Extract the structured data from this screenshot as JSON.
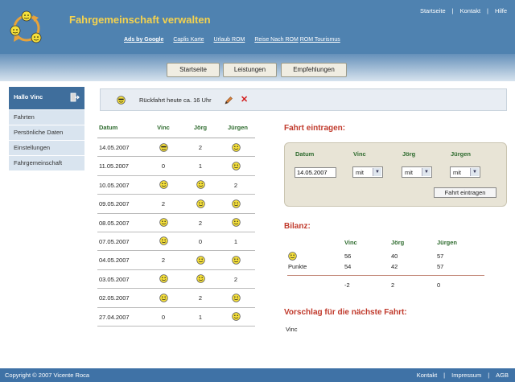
{
  "header": {
    "title": "Fahrgemeinschaft verwalten",
    "topnav": [
      "Startseite",
      "Kontakt",
      "Hilfe"
    ],
    "ads_label": "Ads by Google",
    "ad_links": [
      "Caplis Karte",
      "Urlaub ROM",
      "Reise Nach ROM",
      "ROM Tourismus"
    ]
  },
  "tabs": [
    "Startseite",
    "Leistungen",
    "Empfehlungen"
  ],
  "sidebar": {
    "greeting": "Hallo Vinc",
    "items": [
      "Fahrten",
      "Persönliche Daten",
      "Einstellungen",
      "Fahrgemeinschaft"
    ]
  },
  "notice": {
    "text": "Rückfahrt heute ca. 16 Uhr"
  },
  "rides": {
    "headers": [
      "Datum",
      "Vinc",
      "Jörg",
      "Jürgen"
    ],
    "rows": [
      {
        "date": "14.05.2007",
        "cells": [
          "driver",
          "2",
          "smile"
        ]
      },
      {
        "date": "11.05.2007",
        "cells": [
          "0",
          "1",
          "smile"
        ]
      },
      {
        "date": "10.05.2007",
        "cells": [
          "smile",
          "smile",
          "2"
        ]
      },
      {
        "date": "09.05.2007",
        "cells": [
          "2",
          "smile",
          "smile"
        ]
      },
      {
        "date": "08.05.2007",
        "cells": [
          "smile",
          "2",
          "smile"
        ]
      },
      {
        "date": "07.05.2007",
        "cells": [
          "smile",
          "0",
          "1"
        ]
      },
      {
        "date": "04.05.2007",
        "cells": [
          "2",
          "smile",
          "smile"
        ]
      },
      {
        "date": "03.05.2007",
        "cells": [
          "smile",
          "smile",
          "2"
        ]
      },
      {
        "date": "02.05.2007",
        "cells": [
          "smile",
          "2",
          "smile"
        ]
      },
      {
        "date": "27.04.2007",
        "cells": [
          "0",
          "1",
          "smile"
        ]
      }
    ]
  },
  "entry": {
    "heading": "Fahrt eintragen:",
    "headers": [
      "Datum",
      "Vinc",
      "Jörg",
      "Jürgen"
    ],
    "date_value": "14.05.2007",
    "selects": [
      "mit",
      "mit",
      "mit"
    ],
    "submit_label": "Fahrt eintragen"
  },
  "bilanz": {
    "heading": "Bilanz:",
    "headers": [
      "Vinc",
      "Jörg",
      "Jürgen"
    ],
    "smile_row": [
      "56",
      "40",
      "57"
    ],
    "points_label": "Punkte",
    "points_row": [
      "54",
      "42",
      "57"
    ],
    "diff_row": [
      "-2",
      "2",
      "0"
    ]
  },
  "vorschlag": {
    "heading": "Vorschlag für die nächste Fahrt:",
    "name": "Vinc"
  },
  "footer": {
    "copyright": "Copyright © 2007  Vicente Roca",
    "links": [
      "Kontakt",
      "Impressum",
      "AGB"
    ]
  },
  "colors": {
    "header_bg": "#4f82b0",
    "title": "#f4d24f",
    "heading_red": "#c0392b",
    "table_head_green": "#2e6b2e",
    "sidebar_active": "#3f6e9c",
    "sidebar_item": "#d9e4ef"
  }
}
